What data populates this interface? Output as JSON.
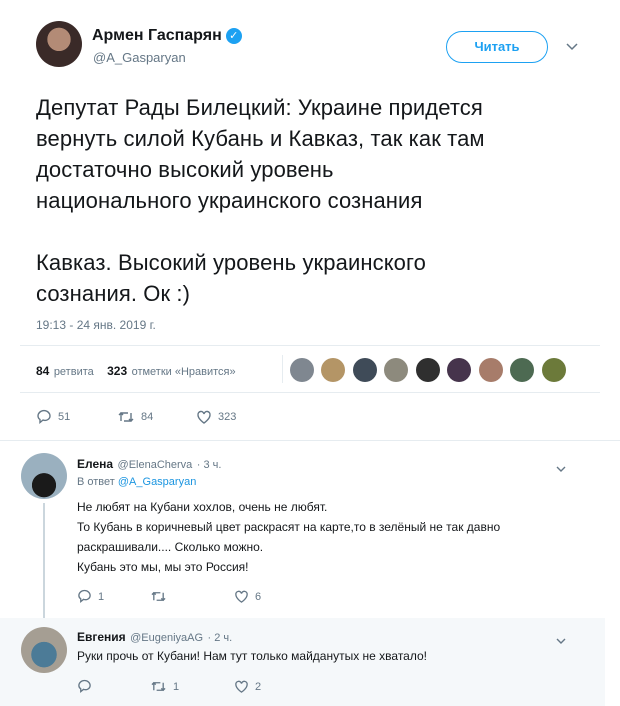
{
  "author": {
    "name": "Армен Гаспарян",
    "handle": "@A_Gasparyan",
    "follow_label": "Читать"
  },
  "tweet": {
    "lines": [
      "Депутат Рады Билецкий: Украине придется",
      "вернуть силой Кубань и Кавказ, так как там",
      "достаточно высокий уровень",
      "национального украинского сознания",
      "",
      "Кавказ. Высокий уровень украинского",
      "сознания. Ок :)"
    ],
    "timestamp": "19:13 - 24 янв. 2019 г.",
    "retweets_count": "84",
    "retweets_label": "ретвита",
    "likes_count": "323",
    "likes_label": "отметки «Нравится»",
    "actions": {
      "replies": "51",
      "retweets": "84",
      "likes": "323"
    }
  },
  "replies": [
    {
      "name": "Елена",
      "handle": "@ElenaCherva",
      "time": "· 3 ч.",
      "in_reply_prefix": "В ответ",
      "in_reply_to": "@A_Gasparyan",
      "text_lines": [
        "Не любят на Кубани хохлов, очень не любят.",
        "То Кубань в коричневый цвет раскрасят на карте,то в зелёный не так давно",
        "раскрашивали.... Сколько можно.",
        "Кубань это мы, мы это Россия!"
      ],
      "actions": {
        "replies": "1",
        "retweets": "",
        "likes": "6"
      }
    },
    {
      "name": "Евгения",
      "handle": "@EugeniyaAG",
      "time": "· 2 ч.",
      "text_lines": [
        "Руки прочь от Кубани! Нам тут только майданутых не хватало!"
      ],
      "actions": {
        "replies": "",
        "retweets": "1",
        "likes": "2"
      }
    }
  ],
  "colors": {
    "accent": "#1da1f2",
    "muted": "#657786",
    "divider": "#e6ecf0"
  }
}
